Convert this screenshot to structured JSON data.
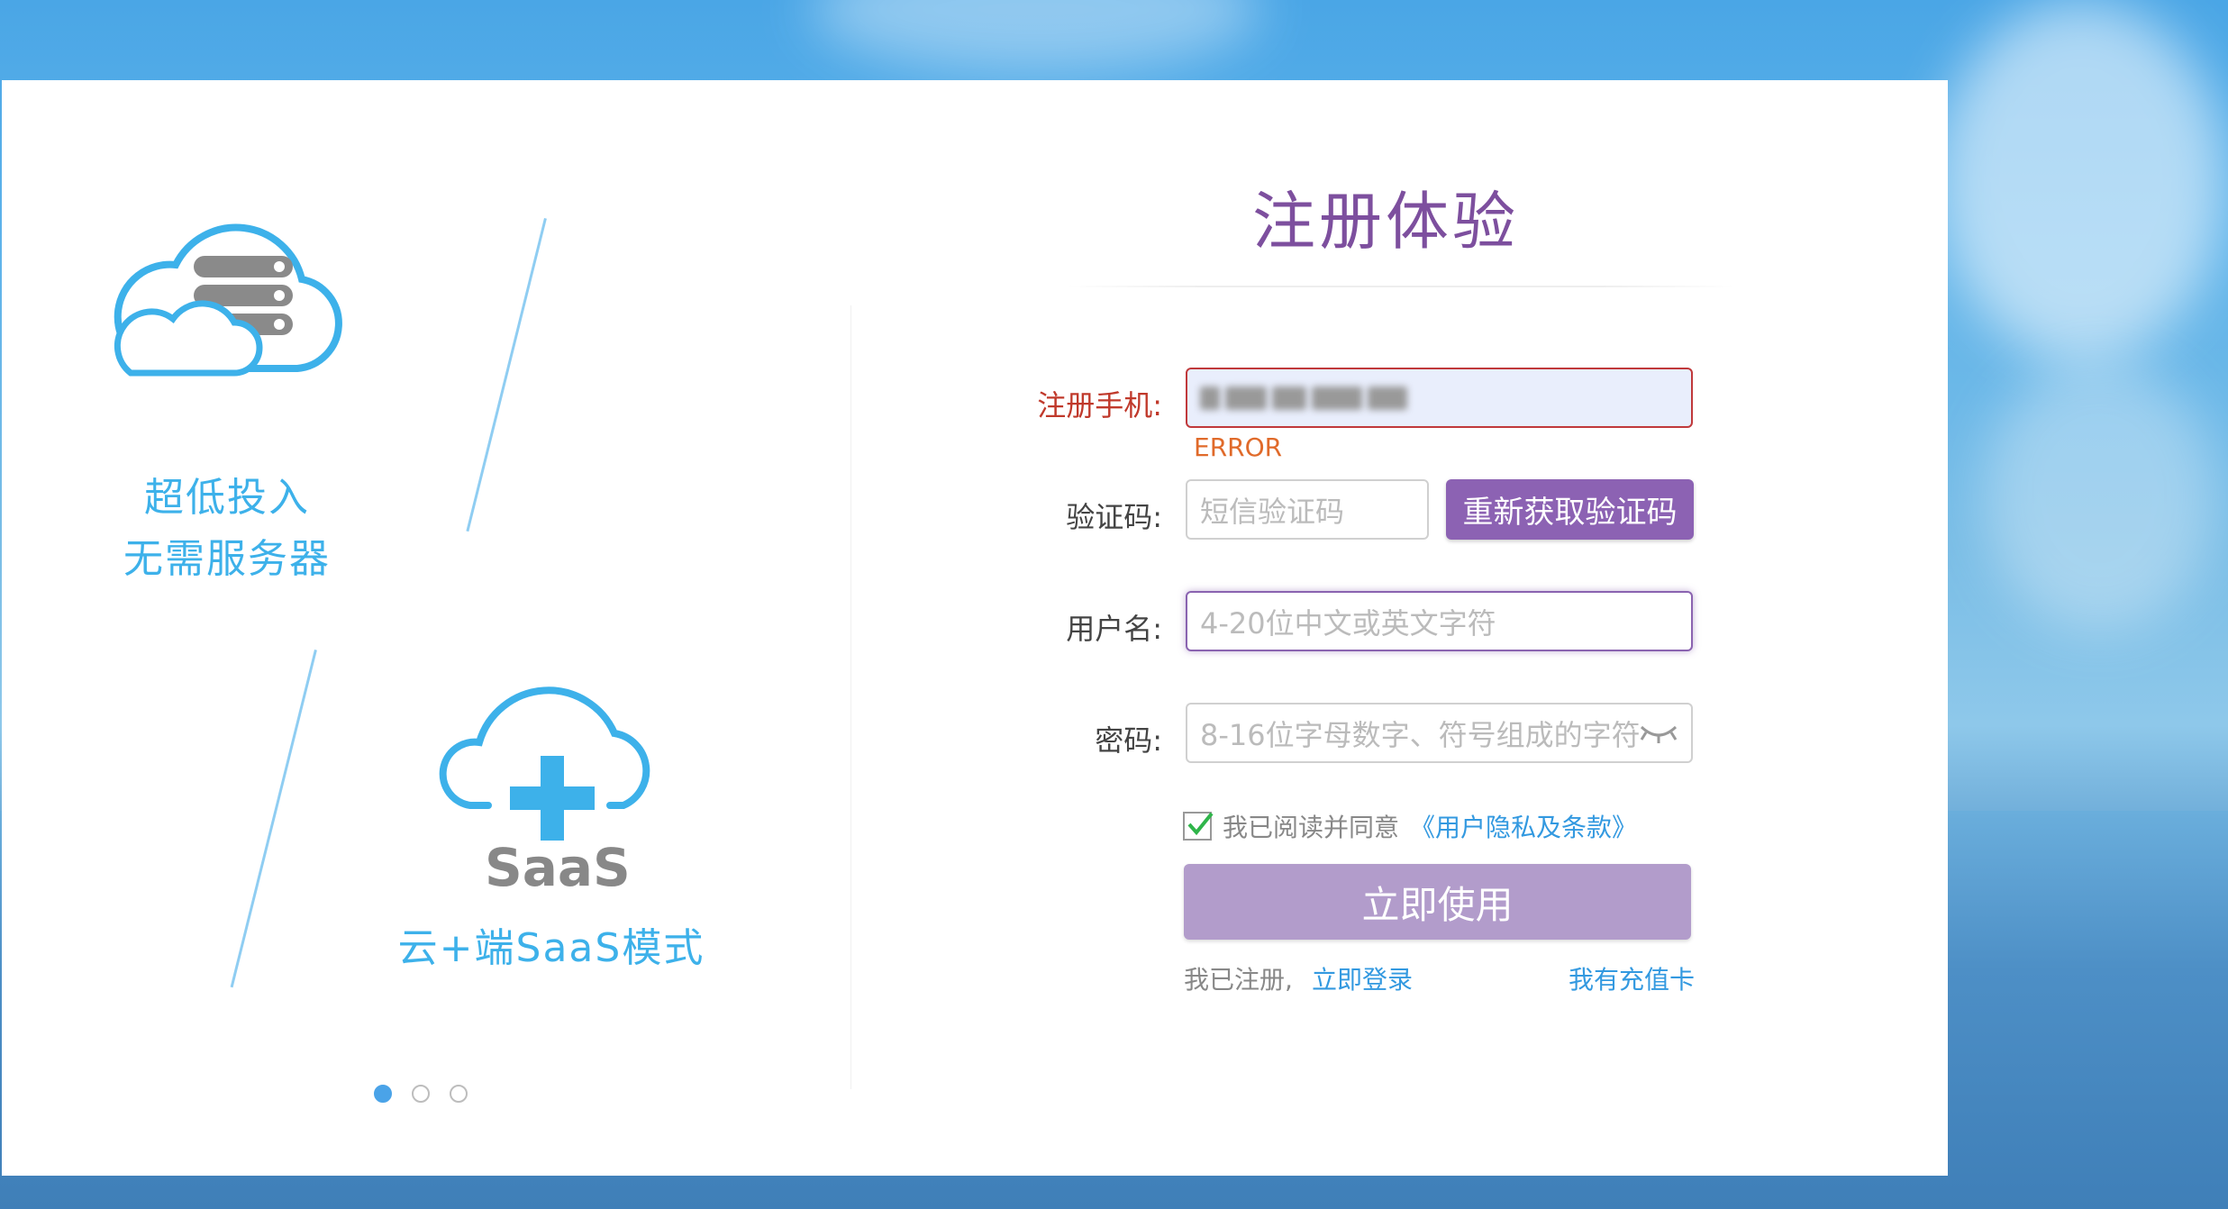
{
  "title": "注册体验",
  "features": [
    {
      "line1": "超低投入",
      "line2": "无需服务器"
    },
    {
      "brand": "SaaS",
      "line1": "云+端SaaS模式"
    }
  ],
  "form": {
    "phone": {
      "label": "注册手机:",
      "error": "ERROR"
    },
    "code": {
      "label": "验证码:",
      "placeholder": "短信验证码",
      "button": "重新获取验证码"
    },
    "username": {
      "label": "用户名:",
      "placeholder": "4-20位中文或英文字符"
    },
    "password": {
      "label": "密码:",
      "placeholder": "8-16位字母数字、符号组成的字符"
    },
    "agree": {
      "text": "我已阅读并同意",
      "link": "《用户隐私及条款》",
      "checked": true
    },
    "submit": "立即使用",
    "already": "我已注册,",
    "login": "立即登录",
    "recharge": "我有充值卡"
  },
  "carousel": {
    "count": 3,
    "active": 0
  },
  "colors": {
    "accent": "#8c62b3",
    "title": "#7d4f9e",
    "feature": "#3db1ea",
    "link": "#3399e0",
    "error": "#c0392b"
  }
}
